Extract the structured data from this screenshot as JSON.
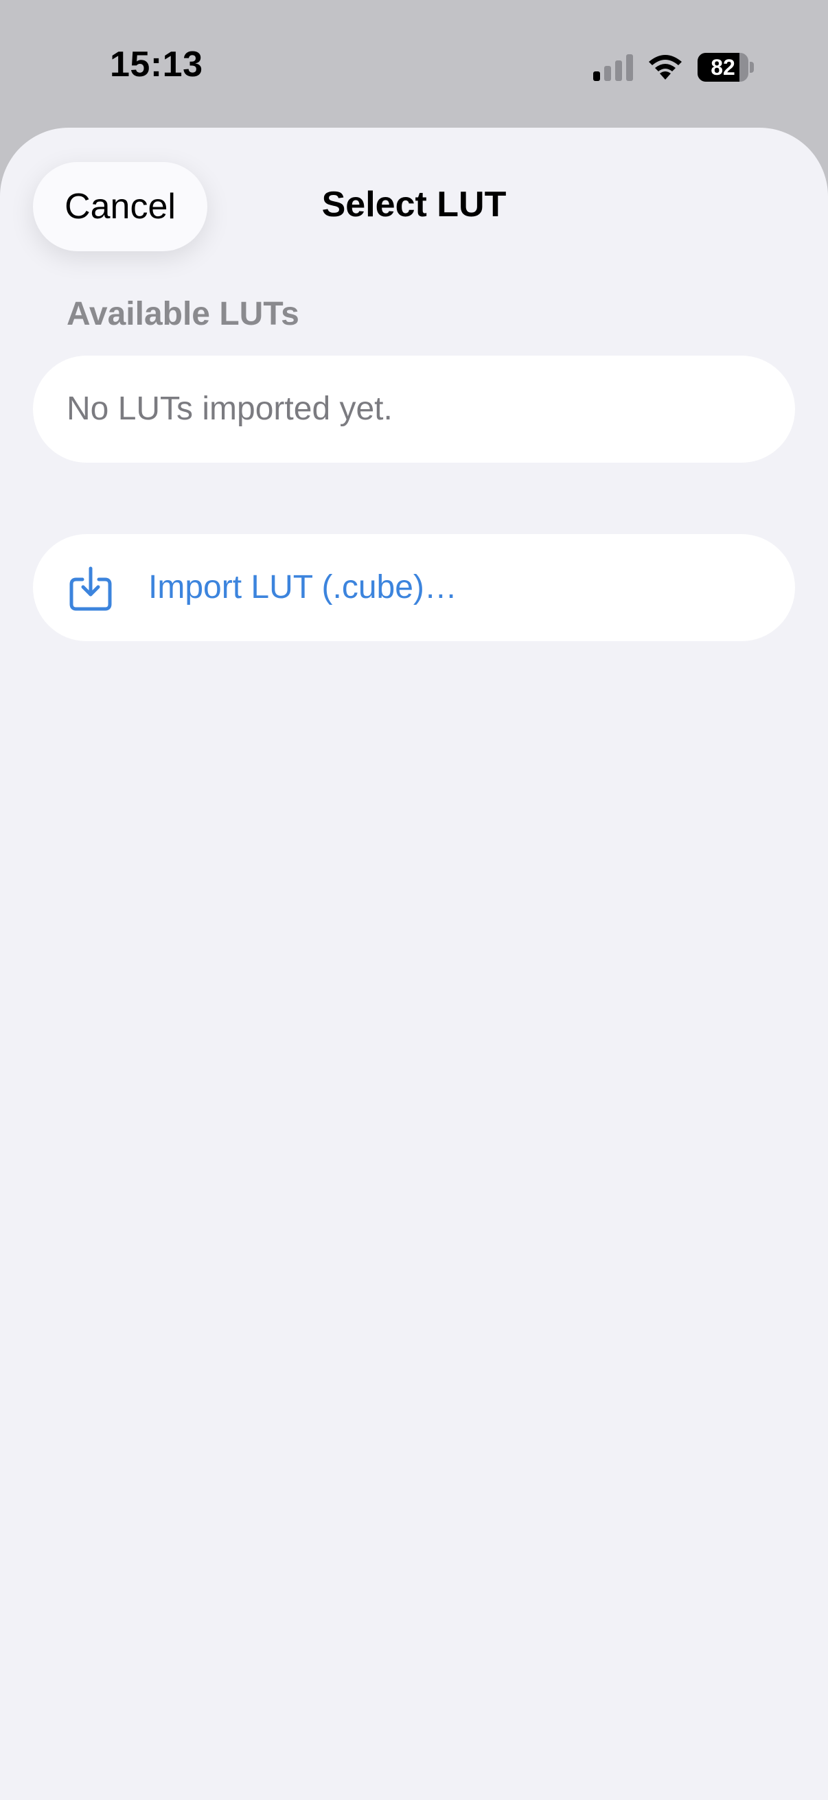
{
  "status_bar": {
    "time": "15:13",
    "battery_level": "82",
    "signal_icon": "cellular-signal-icon",
    "wifi_icon": "wifi-icon"
  },
  "sheet": {
    "title": "Select LUT",
    "cancel_label": "Cancel",
    "section_header": "Available LUTs",
    "empty_message": "No LUTs imported yet.",
    "import_label": "Import LUT (.cube)…",
    "import_icon": "tray-arrow-down-icon"
  },
  "colors": {
    "accent": "#3c84dd",
    "sheet_background": "#f2f2f7",
    "card_background": "#ffffff"
  }
}
